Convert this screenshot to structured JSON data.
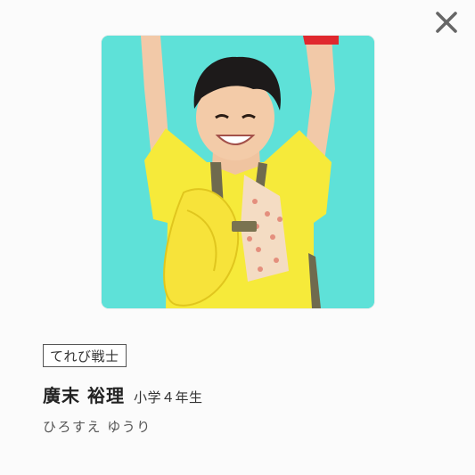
{
  "dialog": {
    "close_icon": "close-icon",
    "photo_alt": "",
    "tag_label": "てれび戦士",
    "name": "廣末 裕理",
    "grade": "小学４年生",
    "reading": "ひろすえ ゆうり"
  },
  "colors": {
    "photo_background": "#5ee1d8",
    "shirt": "#f6ea3a",
    "close_icon": "#666666"
  }
}
